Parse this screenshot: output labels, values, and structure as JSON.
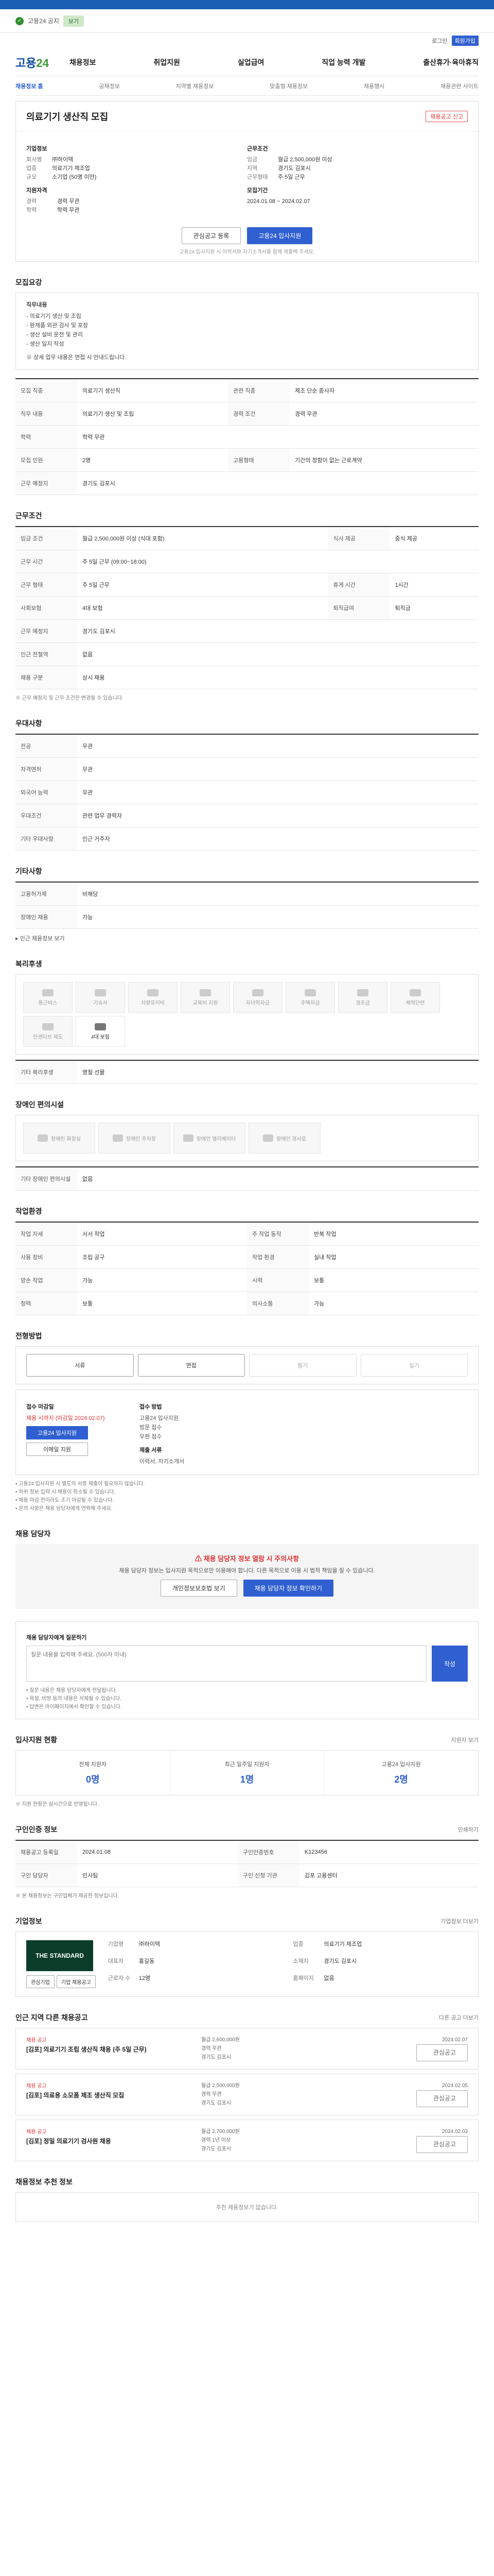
{
  "top": {
    "notice_text": "고용24 공지",
    "notice_btn": "보기"
  },
  "util": [
    "로그인",
    "회원가입"
  ],
  "logo": {
    "main": "고용",
    "sub": "24"
  },
  "gnb": [
    "채용정보",
    "취업지원",
    "실업급여",
    "직업 능력 개발",
    "출산휴가·육아휴직"
  ],
  "lnb": [
    "채용정보 홈",
    "공채정보",
    "지역별 채용정보",
    "맞춤형 채용정보",
    "채용행사",
    "채용관련 사이트"
  ],
  "job": {
    "title": "의료기기 생산직 모집",
    "tag": "채용공고 신고",
    "company_label": "기업정보",
    "company": [
      {
        "k": "회사명",
        "v": "㈜하이텍"
      },
      {
        "k": "업종",
        "v": "의료기기 제조업"
      },
      {
        "k": "규모",
        "v": "소기업 (50명 미만)"
      }
    ],
    "cond_label": "근무조건",
    "cond": [
      {
        "k": "임금",
        "v": "월급 2,500,000원 이상"
      },
      {
        "k": "지역",
        "v": "경기도 김포시"
      },
      {
        "k": "근무형태",
        "v": "주 5일 근무"
      }
    ],
    "req_label": "지원자격",
    "req": [
      {
        "k": "경력",
        "v": "경력 무관"
      },
      {
        "k": "학력",
        "v": "학력 무관"
      }
    ],
    "period_label": "모집기간",
    "period": "2024.01.08 ~ 2024.02.07",
    "save_btn": "관심공고 등록",
    "apply_btn": "고용24 입사지원",
    "note": "고용24 입사지원 시 이력서와 자기소개서를 함께 제출해 주세요."
  },
  "recruit": {
    "title": "모집요강",
    "duty_label": "직무내용",
    "duties": [
      "- 의료기기 생산 및 조립",
      "- 완제품 외관 검사 및 포장",
      "- 생산 설비 운전 및 관리",
      "- 생산 일지 작성"
    ],
    "extra": "※ 상세 업무 내용은 면접 시 안내드립니다.",
    "rows": [
      [
        "모집 직종",
        "의료기기 생산직",
        "관련 직종",
        "제조 단순 종사자"
      ],
      [
        "직무 내용",
        "의료기기 생산 및 조립",
        "경력 조건",
        "경력 무관"
      ],
      [
        "학력",
        "학력 무관",
        "",
        ""
      ],
      [
        "모집 인원",
        "2명",
        "고용형태",
        "기간의 정함이 없는 근로계약"
      ],
      [
        "근무 예정지",
        "경기도 김포시",
        "",
        ""
      ]
    ]
  },
  "work": {
    "title": "근무조건",
    "rows": [
      [
        "임금 조건",
        "월급 2,500,000원 이상 (식대 포함)",
        "식사 제공",
        "중식 제공"
      ],
      [
        "근무 시간",
        "주 5일 근무 (09:00~18:00)",
        "",
        ""
      ],
      [
        "근무 형태",
        "주 5일 근무",
        "휴게 시간",
        "1시간"
      ],
      [
        "사회보험",
        "4대 보험",
        "퇴직급여",
        "퇴직금"
      ],
      [
        "근무 예정지",
        "경기도 김포시",
        "",
        ""
      ],
      [
        "인근 전철역",
        "없음",
        "",
        ""
      ],
      [
        "채용 구분",
        "상시 채용",
        "",
        ""
      ]
    ],
    "foot": "※ 근무 예정지 및 근무 조건은 변경될 수 있습니다."
  },
  "qual": {
    "title": "우대사항",
    "rows": [
      [
        "전공",
        "무관"
      ],
      [
        "자격면허",
        "무관"
      ],
      [
        "외국어 능력",
        "무관"
      ],
      [
        "우대조건",
        "관련 업무 경력자"
      ],
      [
        "기타 우대사항",
        "인근 거주자"
      ]
    ]
  },
  "etc": {
    "title": "기타사항",
    "rows": [
      [
        "고용허가제",
        "비해당"
      ],
      [
        "장애인 채용",
        "가능"
      ]
    ],
    "link": "▸ 인근 채용정보 보기"
  },
  "welfare": {
    "title": "복리후생",
    "items": [
      "통근버스",
      "기숙사",
      "차량유지비",
      "교육비 지원",
      "자녀학자금",
      "주택자금",
      "경조금",
      "체력단련",
      "인센티브 제도",
      "4대 보험"
    ],
    "on_index": 9,
    "etc_label": "기타 복리후생",
    "etc": "명절 선물"
  },
  "disab": {
    "title": "장애인 편의시설",
    "items": [
      "장애인 화장실",
      "장애인 주차장",
      "장애인 엘리베이터",
      "장애인 경사로"
    ],
    "etc_label": "기타 장애인 편의시설",
    "etc": "없음"
  },
  "env": {
    "title": "작업환경",
    "rows": [
      [
        "작업 자세",
        "서서 작업",
        "주 작업 동작",
        "반복 작업"
      ],
      [
        "사용 장비",
        "조립 공구",
        "작업 환경",
        "실내 작업"
      ],
      [
        "양손 작업",
        "가능",
        "시력",
        "보통"
      ],
      [
        "청력",
        "보통",
        "의사소통",
        "가능"
      ]
    ]
  },
  "process": {
    "title": "전형방법",
    "steps": [
      "서류",
      "면접",
      "필기",
      "실기"
    ],
    "on": [
      0,
      1
    ]
  },
  "apply": {
    "period_label": "접수 마감일",
    "deadline": "채용 시까지 (마감일 2024.02.07)",
    "btn1": "고용24 입사지원",
    "btn2": "이메일 지원",
    "method_label": "접수 방법",
    "methods": [
      "고용24 입사지원",
      "방문 접수",
      "우편 접수"
    ],
    "docs_label": "제출 서류",
    "docs": "이력서, 자기소개서",
    "bullets": [
      "• 고용24 입사지원 시 별도의 서류 제출이 필요하지 않습니다.",
      "• 허위 정보 입력 시 채용이 취소될 수 있습니다.",
      "• 채용 마감 전이라도 조기 마감될 수 있습니다.",
      "• 문의 사항은 채용 담당자에게 연락해 주세요."
    ]
  },
  "contact": {
    "title": "채용 담당자",
    "alert_head": "채용 담당자 정보 열람 시 주의사항",
    "alert_txt": "채용 담당자 정보는 입사지원 목적으로만 이용해야 합니다. 다른 목적으로 이용 시 법적 책임을 질 수 있습니다.",
    "btn1": "개인정보보호법 보기",
    "btn2": "채용 담당자 정보 확인하기"
  },
  "inquiry": {
    "label": "채용 담당자에게 질문하기",
    "placeholder": "질문 내용을 입력해 주세요. (500자 이내)",
    "send": "작성",
    "bullets": [
      "• 질문 내용은 채용 담당자에게 전달됩니다.",
      "• 욕설, 비방 등의 내용은 삭제될 수 있습니다.",
      "• 답변은 마이페이지에서 확인할 수 있습니다."
    ]
  },
  "stats": {
    "title": "입사지원 현황",
    "more": "지원자 보기",
    "items": [
      {
        "k": "전체 지원자",
        "v": "0명"
      },
      {
        "k": "최근 일주일 지원자",
        "v": "1명"
      },
      {
        "k": "고용24 입사지원",
        "v": "2명"
      }
    ],
    "note": "※ 지원 현황은 실시간으로 반영됩니다."
  },
  "meta": {
    "title": "구인인증 정보",
    "more": "인쇄하기",
    "rows": [
      [
        "채용공고 등록일",
        "2024.01.08",
        "구인인증번호",
        "K123456"
      ],
      [
        "구인 담당자",
        "인사팀",
        "구인 신청 기관",
        "김포 고용센터"
      ]
    ],
    "note": "※ 본 채용정보는 구인업체가 제공한 정보입니다."
  },
  "company": {
    "title": "기업정보",
    "more": "기업정보 더보기",
    "logo": "THE STANDARD",
    "btn1": "관심기업",
    "btn2": "기업 채용공고",
    "rows": [
      [
        "기업명",
        "㈜하이텍"
      ],
      [
        "업종",
        "의료기기 제조업"
      ],
      [
        "대표자",
        "홍길동"
      ],
      [
        "소재지",
        "경기도 김포시"
      ],
      [
        "근로자 수",
        "12명"
      ],
      [
        "홈페이지",
        "없음"
      ]
    ]
  },
  "related": {
    "title": "인근 지역 다른 채용공고",
    "more": "다른 공고 더보기",
    "jobs": [
      {
        "tag": "채용 공고",
        "t": "[김포] 의료기기 조립 생산직 채용 (주 5일 근무)",
        "m": [
          "월급 2,600,000원",
          "경력 무관",
          "경기도 김포시"
        ],
        "r": [
          "2024.02.07",
          "관심공고"
        ]
      },
      {
        "tag": "채용 공고",
        "t": "[김포] 의료용 소모품 제조 생산직 모집",
        "m": [
          "월급 2,500,000원",
          "경력 무관",
          "경기도 김포시"
        ],
        "r": [
          "2024.02.05",
          "관심공고"
        ]
      },
      {
        "tag": "채용 공고",
        "t": "[김포] 정밀 의료기기 검사원 채용",
        "m": [
          "월급 2,700,000원",
          "경력 1년 이상",
          "경기도 김포시"
        ],
        "r": [
          "2024.02.03",
          "관심공고"
        ]
      }
    ]
  },
  "recommend": {
    "title": "채용정보 추천 정보",
    "empty": "추천 채용정보가 없습니다."
  }
}
